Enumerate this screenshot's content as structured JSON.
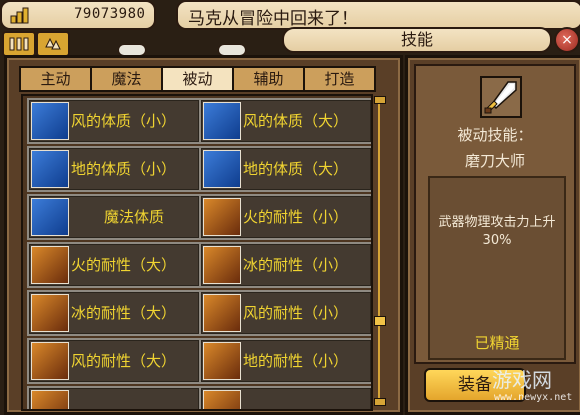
{
  "header": {
    "gold_value": "79073980",
    "message": "马克从冒险中回来了！"
  },
  "window": {
    "title": "技能",
    "close_label": "×"
  },
  "tabs": [
    {
      "label": "主动",
      "active": false
    },
    {
      "label": "魔法",
      "active": false
    },
    {
      "label": "被动",
      "active": true
    },
    {
      "label": "辅助",
      "active": false
    },
    {
      "label": "打造",
      "active": false
    }
  ],
  "skills": [
    {
      "label": "风的体质（小）",
      "icon": "blue-wind-icon"
    },
    {
      "label": "风的体质（大）",
      "icon": "blue-wind-icon"
    },
    {
      "label": "地的体质（小）",
      "icon": "blue-earth-icon"
    },
    {
      "label": "地的体质（大）",
      "icon": "blue-earth-icon"
    },
    {
      "label": "魔法体质",
      "icon": "blue-magic-icon"
    },
    {
      "label": "火的耐性（小）",
      "icon": "orange-fire-icon"
    },
    {
      "label": "火的耐性（大）",
      "icon": "orange-fire-icon"
    },
    {
      "label": "冰的耐性（小）",
      "icon": "orange-ice-icon"
    },
    {
      "label": "冰的耐性（大）",
      "icon": "orange-ice-icon"
    },
    {
      "label": "风的耐性（小）",
      "icon": "orange-wind-icon"
    },
    {
      "label": "风的耐性（大）",
      "icon": "orange-wind-icon"
    },
    {
      "label": "地的耐性（小）",
      "icon": "orange-earth-icon"
    }
  ],
  "detail": {
    "type_label": "被动技能：",
    "name": "磨刀大师",
    "description": "武器物理攻击力上升30%",
    "status": "已精通",
    "equip_label": "装备"
  },
  "watermark": {
    "text": "游戏网",
    "url": "www.newyx.net"
  },
  "colors": {
    "panel_bg": "#5a3f27",
    "label_yellow": "#f0d431",
    "tab_active": "#f4e3bf",
    "tab_inactive": "#cc9f5c"
  }
}
